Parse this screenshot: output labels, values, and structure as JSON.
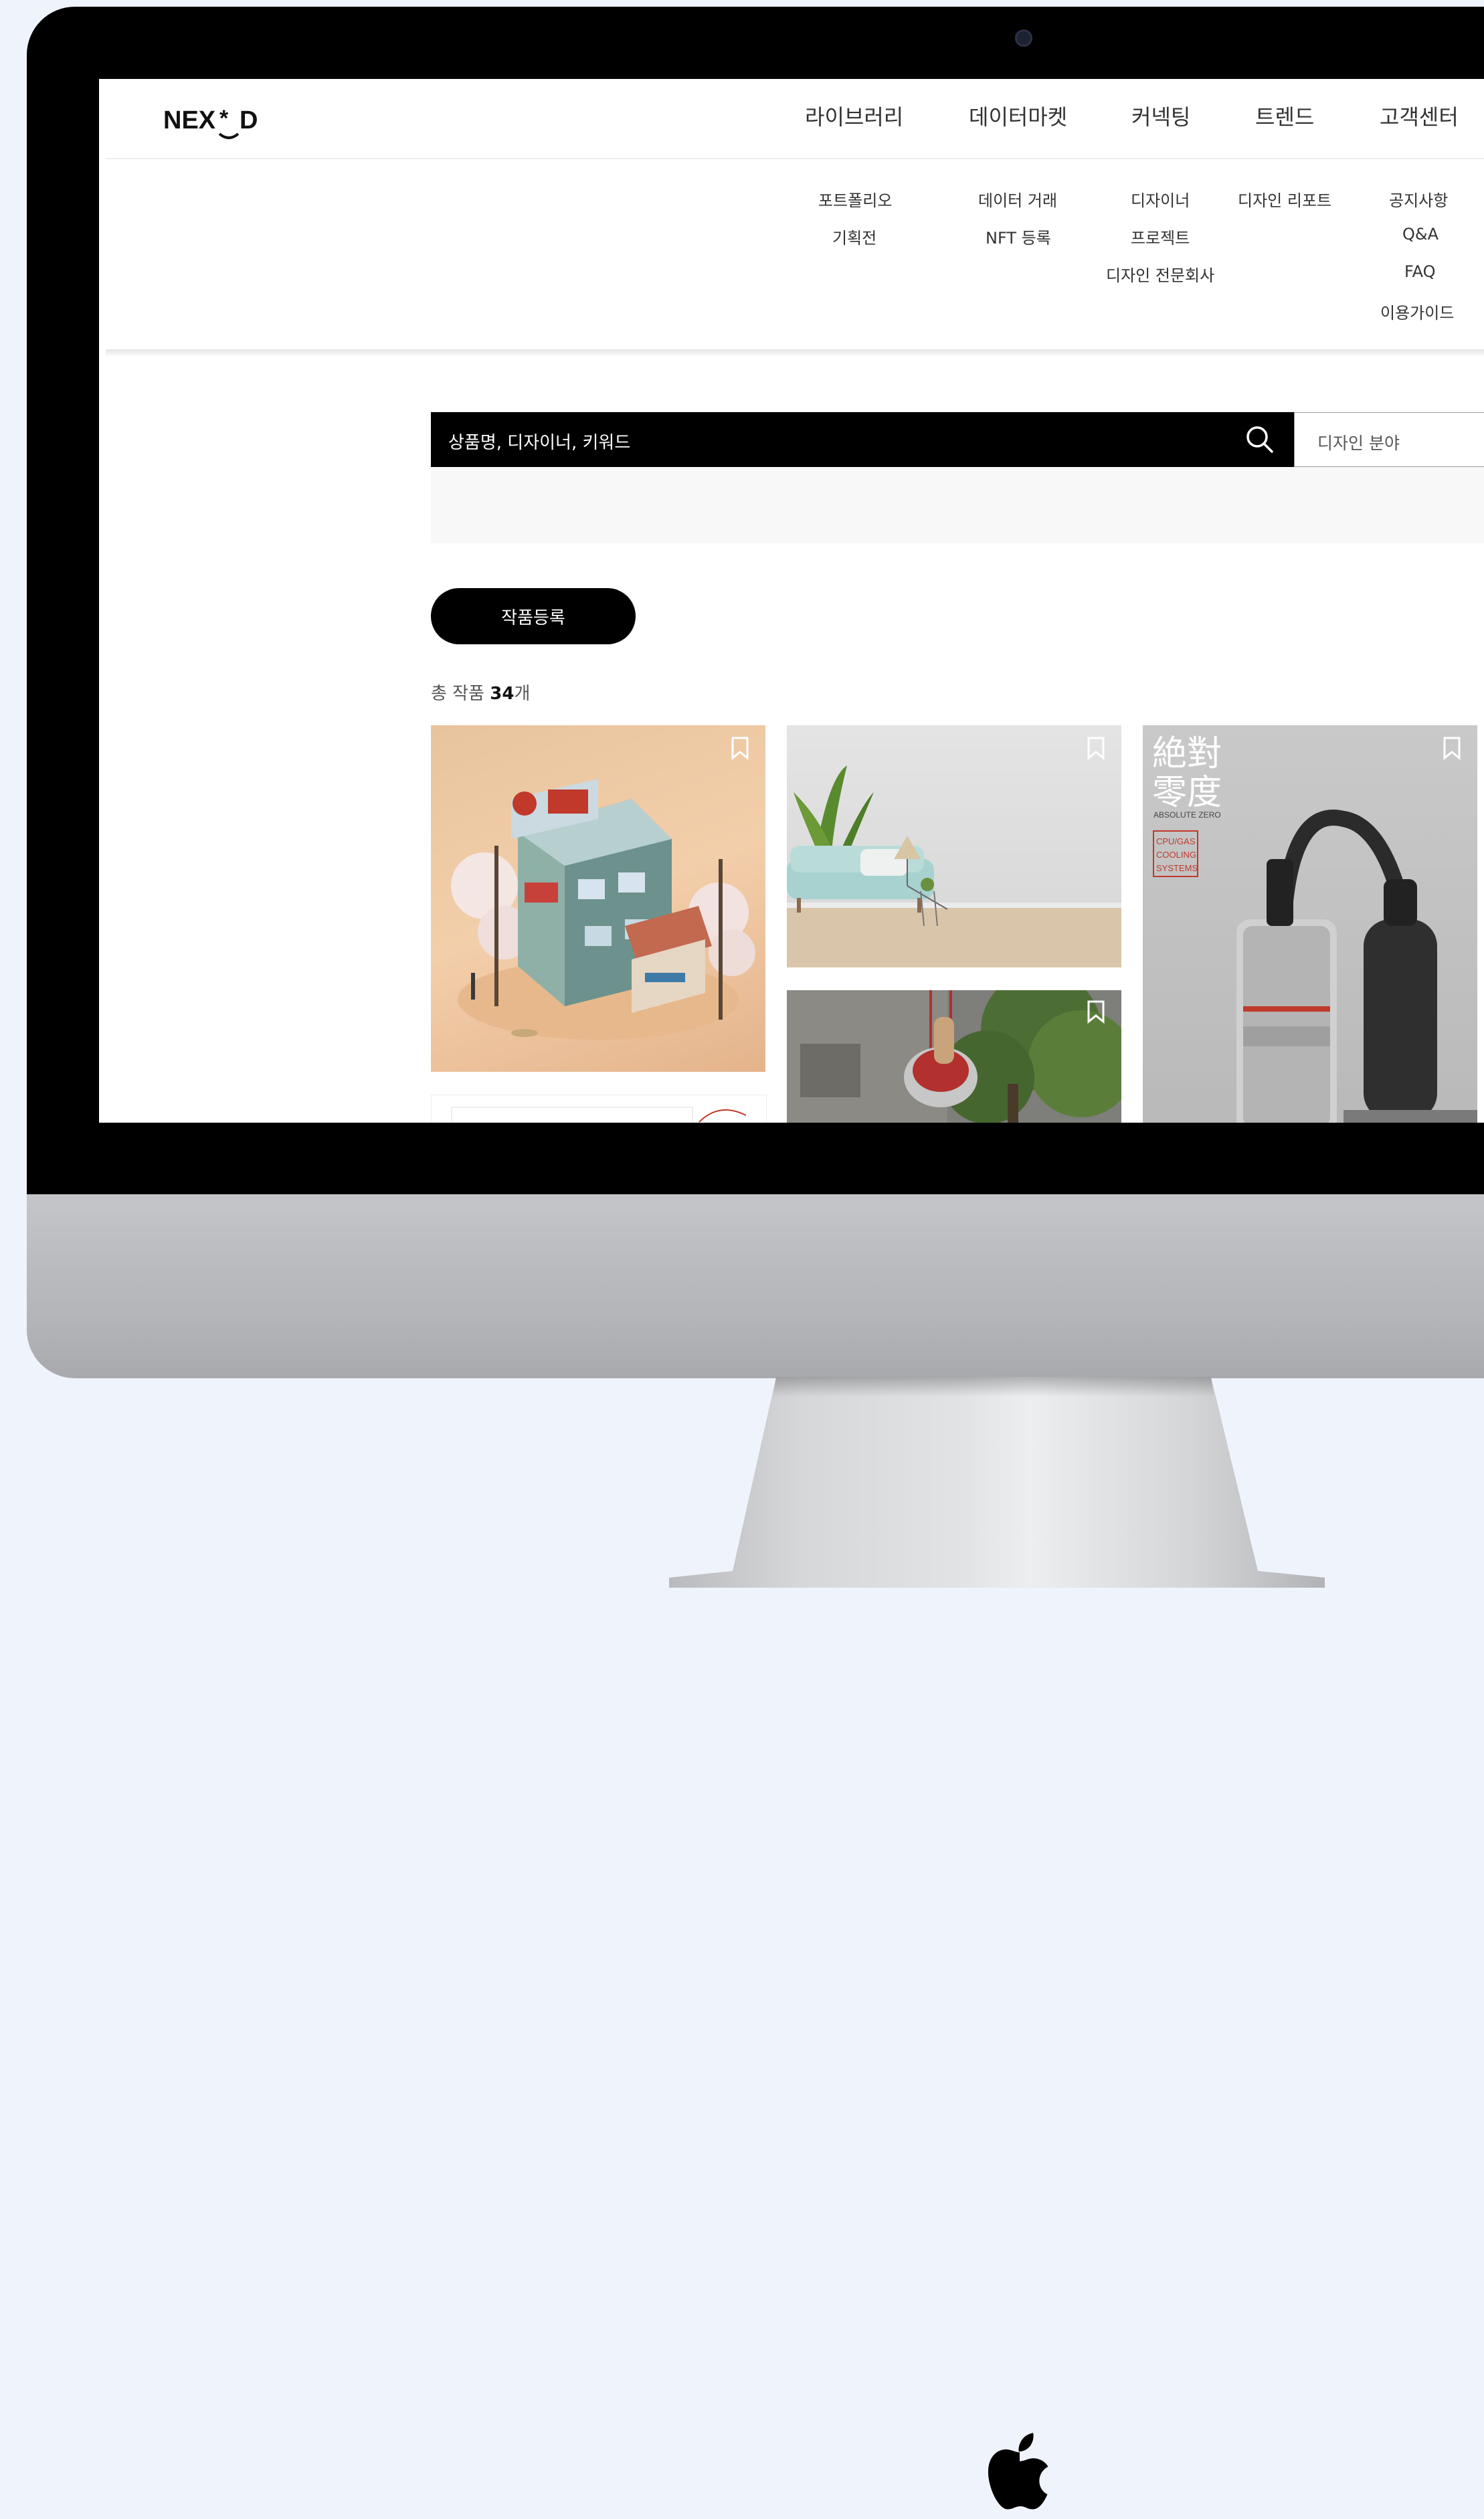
{
  "brand": {
    "logo_text": "NEX*D"
  },
  "gnb": [
    {
      "label": "라이브러리",
      "sub": [
        "포트폴리오",
        "기획전"
      ]
    },
    {
      "label": "데이터마켓",
      "sub": [
        "데이터 거래",
        "NFT 등록"
      ]
    },
    {
      "label": "커넥팅",
      "sub": [
        "디자이너",
        "프로젝트",
        "디자인 전문회사"
      ]
    },
    {
      "label": "트렌드",
      "sub": [
        "디자인 리포트"
      ]
    },
    {
      "label": "고객센터",
      "sub": [
        "공지사항",
        "Q&A",
        "FAQ",
        "이용가이드"
      ]
    }
  ],
  "search": {
    "placeholder": "상품명, 디자이너, 키워드",
    "category_label": "디자인 분야"
  },
  "actions": {
    "register_label": "작품등록"
  },
  "summary": {
    "prefix": "총 작품 ",
    "count": "34",
    "suffix": "개"
  },
  "cards": [
    {
      "id": "card-1",
      "image": "isometric-shop-building"
    },
    {
      "id": "card-2",
      "image": "living-room-sofa"
    },
    {
      "id": "card-3",
      "image": "vacuum-cleaner",
      "text_lines": [
        "絶對",
        "零度",
        "ABSOLUTE ZERO",
        "CPU/GAS",
        "COOLING",
        "SYSTEMS"
      ]
    },
    {
      "id": "card-4",
      "image": "chair-in-tree"
    },
    {
      "id": "card-5",
      "image": "partial-card"
    }
  ],
  "colors": {
    "background": "#eff3fb",
    "search_bar": "#000000",
    "accent_red": "#c0392b"
  }
}
